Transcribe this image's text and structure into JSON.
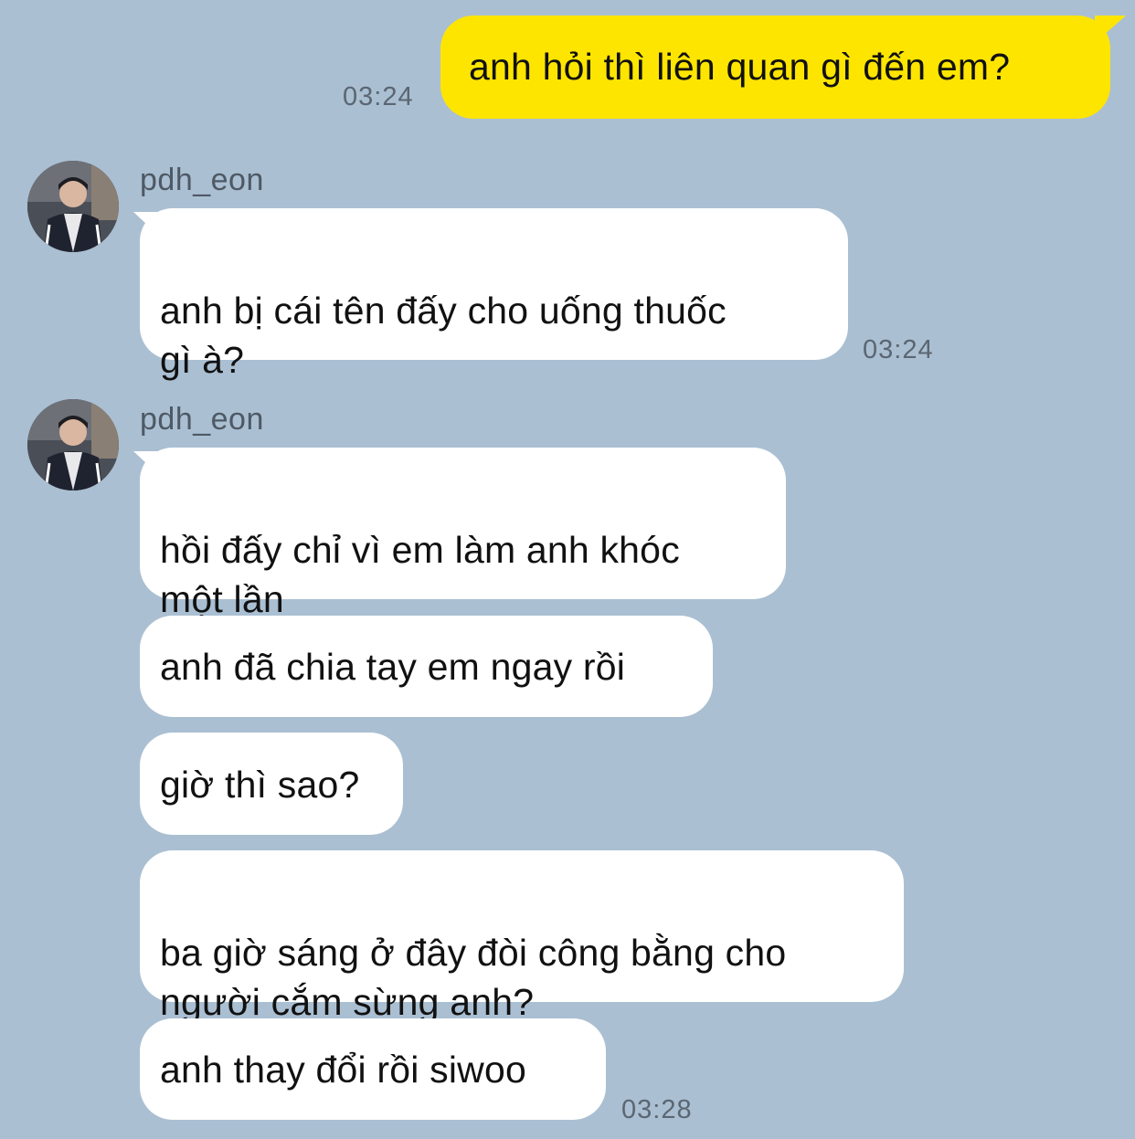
{
  "chat": {
    "outgoing": [
      {
        "text": "anh hỏi thì liên quan gì đến em?",
        "time": "03:24"
      }
    ],
    "groups": [
      {
        "sender": "pdh_eon",
        "avatar_icon": "profile-photo-icon",
        "messages": [
          {
            "text": "anh bị cái tên đấy cho uống thuốc\ngì à?"
          }
        ],
        "time": "03:24"
      },
      {
        "sender": "pdh_eon",
        "avatar_icon": "profile-photo-icon",
        "messages": [
          {
            "text": "hồi đấy chỉ vì em làm anh khóc\nmột lần"
          },
          {
            "text": "anh đã chia tay em ngay rồi"
          },
          {
            "text": "giờ thì sao?"
          },
          {
            "text": "ba giờ sáng ở đây đòi công bằng cho\nngười cắm sừng anh?"
          },
          {
            "text": "anh thay đổi rồi siwoo"
          }
        ],
        "time": "03:28"
      }
    ]
  },
  "colors": {
    "background": "#aabfd2",
    "outgoing_bubble": "#fee500",
    "incoming_bubble": "#ffffff"
  }
}
